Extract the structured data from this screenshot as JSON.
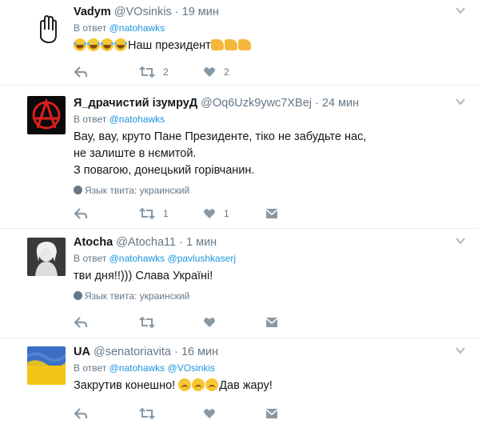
{
  "tweets": [
    {
      "name": "Vadym",
      "handle": "@VOsinkis",
      "sep": "·",
      "time": "19 мин",
      "reply_prefix": "В ответ",
      "reply_to": [
        "@natohawks"
      ],
      "text": "Наш президент",
      "text_lines": [],
      "lang": "",
      "retweets": "2",
      "likes": "2",
      "avatar": "raised-hand-icon"
    },
    {
      "name": "Я_драчистий ізумруД",
      "handle": "@Oq6Uzk9ywc7XBej",
      "sep": "·",
      "time": "24 мин",
      "reply_prefix": "В ответ",
      "reply_to": [
        "@natohawks"
      ],
      "text_lines": [
        "Вау, вау, круто Пане Президенте, тіко не забудьте нас,",
        "не залиште в нємитой.",
        "З повагою, донецький горівчанин."
      ],
      "lang": "Язык твита: украинский",
      "retweets": "1",
      "likes": "1",
      "avatar": "anarchy-symbol"
    },
    {
      "name": "Atocha",
      "handle": "@Atocha11",
      "sep": "·",
      "time": "1 мин",
      "reply_prefix": "В ответ",
      "reply_to": [
        "@natohawks",
        "@pavlushkaserj"
      ],
      "text_lines": [
        "тви дня!!))) Слава Україні!"
      ],
      "lang": "Язык твита: украинский",
      "retweets": "",
      "likes": "",
      "avatar": "portrait-photo"
    },
    {
      "name": "UA",
      "handle": "@senatoriavita",
      "sep": "·",
      "time": "16 мин",
      "reply_prefix": "В ответ",
      "reply_to": [
        "@natohawks",
        "@VOsinkis"
      ],
      "text_before": "Закрутив конешно!",
      "text_after": "Дав жару!",
      "lang": "",
      "retweets": "",
      "likes": "",
      "avatar": "ukraine-flag"
    }
  ],
  "colors": {
    "link": "#1b95e0",
    "muted": "#657786",
    "divider": "#e6ecf0",
    "text": "#14171a"
  }
}
